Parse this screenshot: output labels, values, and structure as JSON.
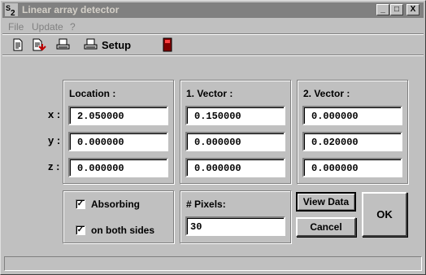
{
  "window": {
    "title": "Linear array detector",
    "minimize_glyph": "_",
    "maximize_glyph": "□",
    "close_glyph": "X"
  },
  "menu": {
    "file": "File",
    "update": "Update",
    "help": "?"
  },
  "toolbar": {
    "setup_label": "Setup",
    "icons": [
      "new-document-icon",
      "open-document-icon",
      "print-icon",
      "printer-setup-icon",
      "exit-door-icon"
    ]
  },
  "form": {
    "row_labels": [
      "x :",
      "y :",
      "z :"
    ],
    "location": {
      "heading": "Location :",
      "x": "2.050000",
      "y": "0.000000",
      "z": "0.000000"
    },
    "vector1": {
      "heading": "1. Vector :",
      "x": "0.150000",
      "y": "0.000000",
      "z": "0.000000"
    },
    "vector2": {
      "heading": "2. Vector :",
      "x": "0.000000",
      "y": "0.020000",
      "z": "0.000000"
    },
    "absorbing": {
      "label": "Absorbing",
      "checked": true,
      "mark": "✓"
    },
    "both_sides": {
      "label": "on both sides",
      "checked": true,
      "mark": "✓"
    },
    "pixels": {
      "heading": "# Pixels:",
      "value": "30"
    }
  },
  "buttons": {
    "view_data": "View Data",
    "cancel": "Cancel",
    "ok": "OK"
  },
  "status": {
    "text": ""
  },
  "colors": {
    "titlebar_inactive": "#808080",
    "face": "#c0c0c0"
  }
}
